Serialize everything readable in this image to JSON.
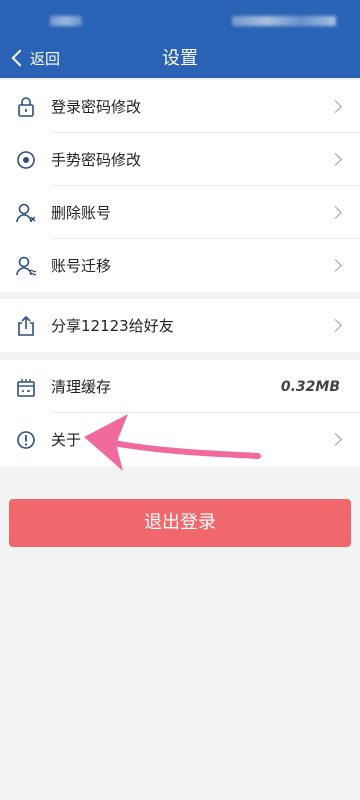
{
  "header": {
    "back_label": "返回",
    "title": "设置",
    "background_color": "#2a63b5"
  },
  "groups": [
    {
      "items": [
        {
          "label": "登录密码修改",
          "icon": "lock-icon"
        },
        {
          "label": "手势密码修改",
          "icon": "target-circle-icon"
        },
        {
          "label": "删除账号",
          "icon": "user-remove-icon"
        },
        {
          "label": "账号迁移",
          "icon": "user-migrate-icon"
        }
      ]
    },
    {
      "items": [
        {
          "label": "分享12123给好友",
          "icon": "share-icon"
        }
      ]
    },
    {
      "items": [
        {
          "label": "清理缓存",
          "icon": "cache-clean-icon",
          "value": "0.32MB"
        },
        {
          "label": "关于",
          "icon": "info-circle-icon"
        }
      ]
    }
  ],
  "logout": {
    "label": "退出登录",
    "color": "#f0686b"
  },
  "annotation": {
    "color": "#f06a9e"
  }
}
